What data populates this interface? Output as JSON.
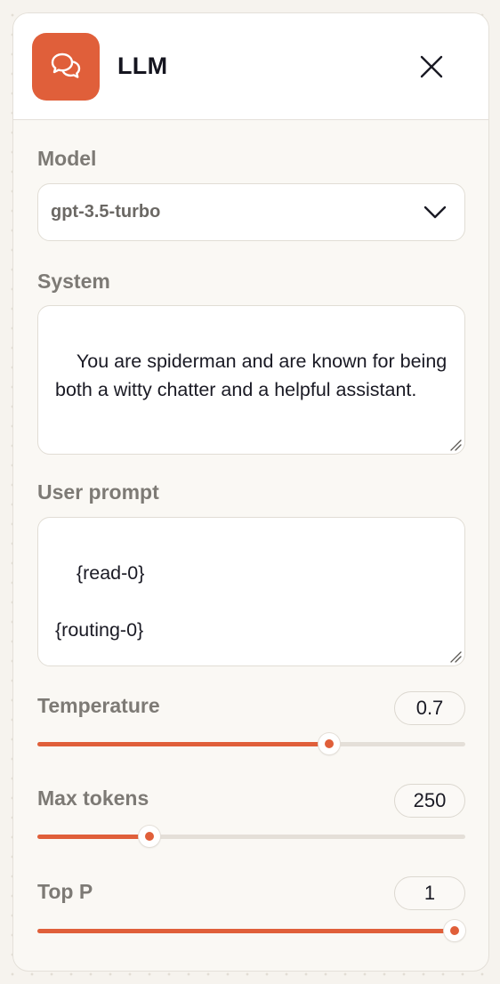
{
  "panel": {
    "title": "LLM",
    "icon": "chat-bubbles-icon",
    "accent_color": "#e05f3a"
  },
  "model": {
    "label": "Model",
    "selected": "gpt-3.5-turbo"
  },
  "system": {
    "label": "System",
    "value": "You are spiderman and are known for being both a witty chatter and a helpful assistant."
  },
  "user_prompt": {
    "label": "User prompt",
    "value": "{read-0}\n\n{routing-0}"
  },
  "temperature": {
    "label": "Temperature",
    "value": "0.7",
    "fraction": 0.691
  },
  "max_tokens": {
    "label": "Max tokens",
    "value": "250",
    "fraction": 0.25
  },
  "top_p": {
    "label": "Top P",
    "value": "1",
    "fraction": 1.0
  }
}
